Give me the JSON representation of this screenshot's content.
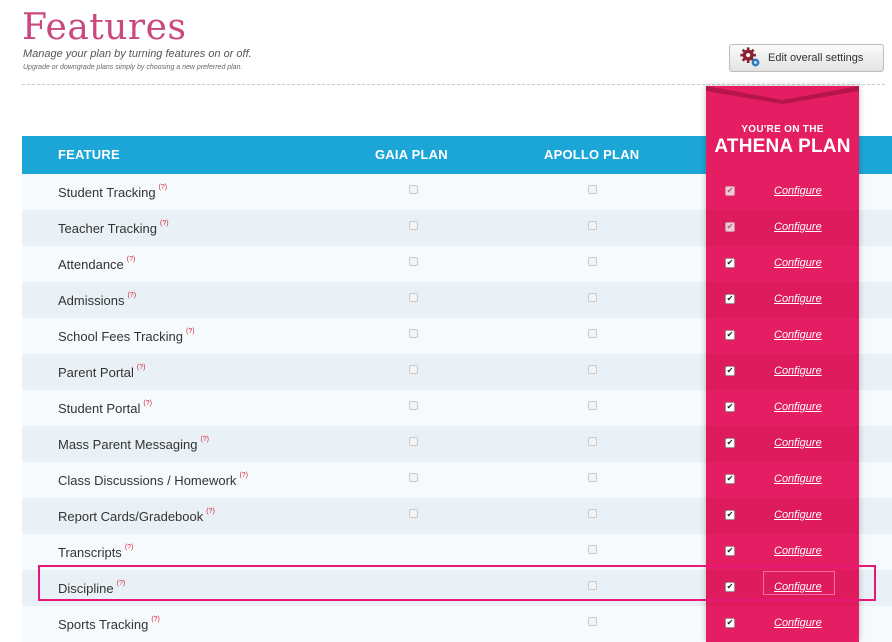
{
  "page": {
    "title": "Features",
    "subtitle": "Manage your plan by turning features on or off.",
    "subnote": "Upgrade or downgrade plans simply by choosing a new preferred plan.",
    "edit_button": "Edit overall settings",
    "edit_icon": "gear-icon"
  },
  "table": {
    "headers": {
      "feature": "FEATURE",
      "gaia": "GAIA PLAN",
      "apollo": "APOLLO PLAN"
    },
    "athena": {
      "prefix": "YOU'RE ON THE",
      "name": "ATHENA PLAN",
      "color": "#e51e63"
    },
    "header_color": "#1ba6d7",
    "help_marker": "(?)",
    "configure_label": "Configure",
    "rows": [
      {
        "feature": "Student Tracking",
        "gaia": false,
        "apollo": false,
        "athena": true,
        "athena_locked": true
      },
      {
        "feature": "Teacher Tracking",
        "gaia": false,
        "apollo": false,
        "athena": true,
        "athena_locked": true
      },
      {
        "feature": "Attendance",
        "gaia": false,
        "apollo": false,
        "athena": true,
        "athena_locked": false
      },
      {
        "feature": "Admissions",
        "gaia": false,
        "apollo": false,
        "athena": true,
        "athena_locked": false
      },
      {
        "feature": "School Fees Tracking",
        "gaia": false,
        "apollo": false,
        "athena": true,
        "athena_locked": false
      },
      {
        "feature": "Parent Portal",
        "gaia": false,
        "apollo": false,
        "athena": true,
        "athena_locked": false
      },
      {
        "feature": "Student Portal",
        "gaia": false,
        "apollo": false,
        "athena": true,
        "athena_locked": false
      },
      {
        "feature": "Mass Parent Messaging",
        "gaia": false,
        "apollo": false,
        "athena": true,
        "athena_locked": false
      },
      {
        "feature": "Class Discussions / Homework",
        "gaia": false,
        "apollo": false,
        "athena": true,
        "athena_locked": false
      },
      {
        "feature": "Report Cards/Gradebook",
        "gaia": false,
        "apollo": false,
        "athena": true,
        "athena_locked": false
      },
      {
        "feature": "Transcripts",
        "gaia": null,
        "apollo": false,
        "athena": true,
        "athena_locked": false
      },
      {
        "feature": "Discipline",
        "gaia": null,
        "apollo": false,
        "athena": true,
        "athena_locked": false,
        "highlighted": true
      },
      {
        "feature": "Sports Tracking",
        "gaia": null,
        "apollo": false,
        "athena": true,
        "athena_locked": false
      }
    ]
  }
}
